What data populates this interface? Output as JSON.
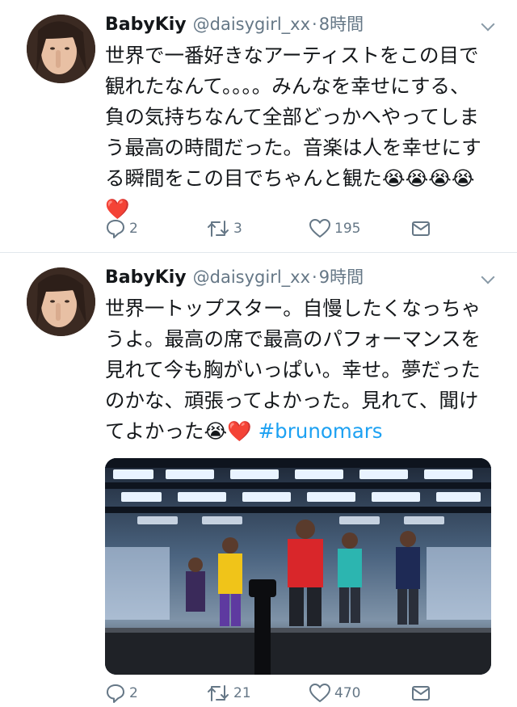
{
  "tweets": [
    {
      "name": "BabyKiy",
      "handle": "@daisygirl_xx",
      "dot": "·",
      "time": "8時間",
      "text": "世界で一番好きなアーティストをこの目で観れたなんて。。。。みんなを幸せにする、負の気持ちなんて全部どっかへやってしまう最高の時間だった。音楽は人を幸せにする瞬間をこの目でちゃんと観た😭😭😭😭❤️",
      "hashtag": "",
      "reply_count": "2",
      "retweet_count": "3",
      "like_count": "195"
    },
    {
      "name": "BabyKiy",
      "handle": "@daisygirl_xx",
      "dot": "·",
      "time": "9時間",
      "text": "世界一トップスター。自慢したくなっちゃうよ。最高の席で最高のパフォーマンスを見れて今も胸がいっぱい。幸せ。夢だったのかな、頑張ってよかった。見れて、聞けてよかった😭❤️",
      "hashtag": "#brunomars",
      "reply_count": "2",
      "retweet_count": "21",
      "like_count": "470"
    }
  ],
  "icons": {
    "reply": "reply-icon",
    "retweet": "retweet-icon",
    "like": "heart-icon",
    "share": "share-icon",
    "more": "chevron-down-icon"
  },
  "colors": {
    "link": "#1da1f2",
    "secondary_text": "#657786",
    "divider": "#e1e8ed"
  }
}
